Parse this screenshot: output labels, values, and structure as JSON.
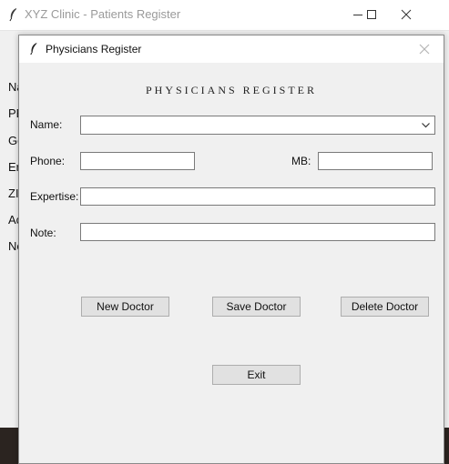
{
  "parent_window": {
    "title": "XYZ Clinic - Patients Register",
    "labels": [
      "Na",
      "PE",
      "Ge",
      "Er",
      "ZI",
      "Ac",
      "Ne"
    ]
  },
  "dialog": {
    "title": "Physicians Register",
    "heading": "PHYSICIANS REGISTER",
    "fields": {
      "name_label": "Name:",
      "name_value": "",
      "phone_label": "Phone:",
      "phone_value": "",
      "mb_label": "MB:",
      "mb_value": "",
      "expertise_label": "Expertise:",
      "expertise_value": "",
      "note_label": "Note:",
      "note_value": ""
    },
    "buttons": {
      "new_doctor": "New Doctor",
      "save_doctor": "Save Doctor",
      "delete_doctor": "Delete Doctor",
      "exit": "Exit"
    }
  },
  "icons": {
    "app": "feather-icon",
    "minimize": "minimize-icon",
    "maximize": "maximize-icon",
    "close": "close-icon",
    "dropdown": "chevron-down-icon"
  }
}
